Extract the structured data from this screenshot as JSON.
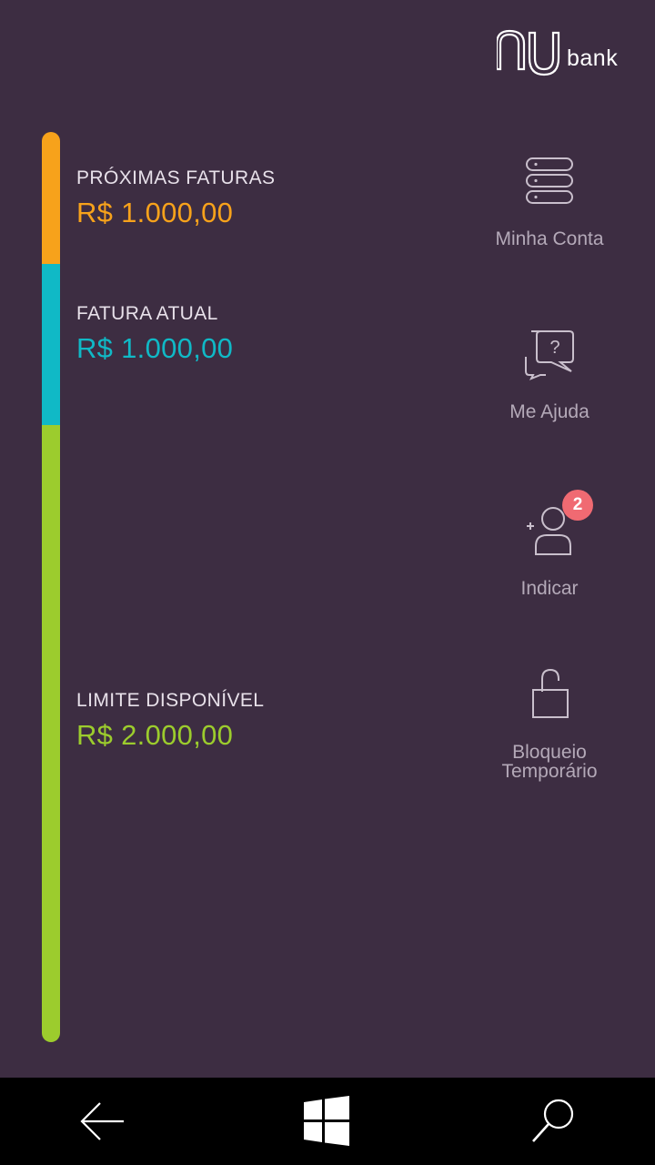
{
  "brand": {
    "wordmark": "bank",
    "logo_icon": "nu-logo-icon"
  },
  "colors": {
    "background": "#3d2d42",
    "proximas": "#f7a21b",
    "atual": "#10b9c6",
    "limite": "#9ccc2d",
    "badge": "#f06a72"
  },
  "summary": {
    "proximas": {
      "label": "PRÓXIMAS FATURAS",
      "value": "R$ 1.000,00"
    },
    "atual": {
      "label": "FATURA ATUAL",
      "value": "R$ 1.000,00"
    },
    "limite": {
      "label": "LIMITE DISPONÍVEL",
      "value": "R$ 2.000,00"
    }
  },
  "limit_bar": {
    "proximas_fraction": 0.145,
    "atual_fraction": 0.177,
    "limite_fraction": 0.678
  },
  "menu": {
    "minha_conta": {
      "label": "Minha Conta",
      "icon": "account-stack-icon"
    },
    "me_ajuda": {
      "label": "Me Ajuda",
      "icon": "help-chat-icon"
    },
    "indicar": {
      "label": "Indicar",
      "icon": "add-user-icon",
      "badge": "2"
    },
    "bloqueio": {
      "label_line1": "Bloqueio",
      "label_line2": "Temporário",
      "icon": "unlocked-padlock-icon"
    }
  },
  "navbar": {
    "back_icon": "back-arrow-icon",
    "home_icon": "windows-logo-icon",
    "search_icon": "search-icon"
  }
}
